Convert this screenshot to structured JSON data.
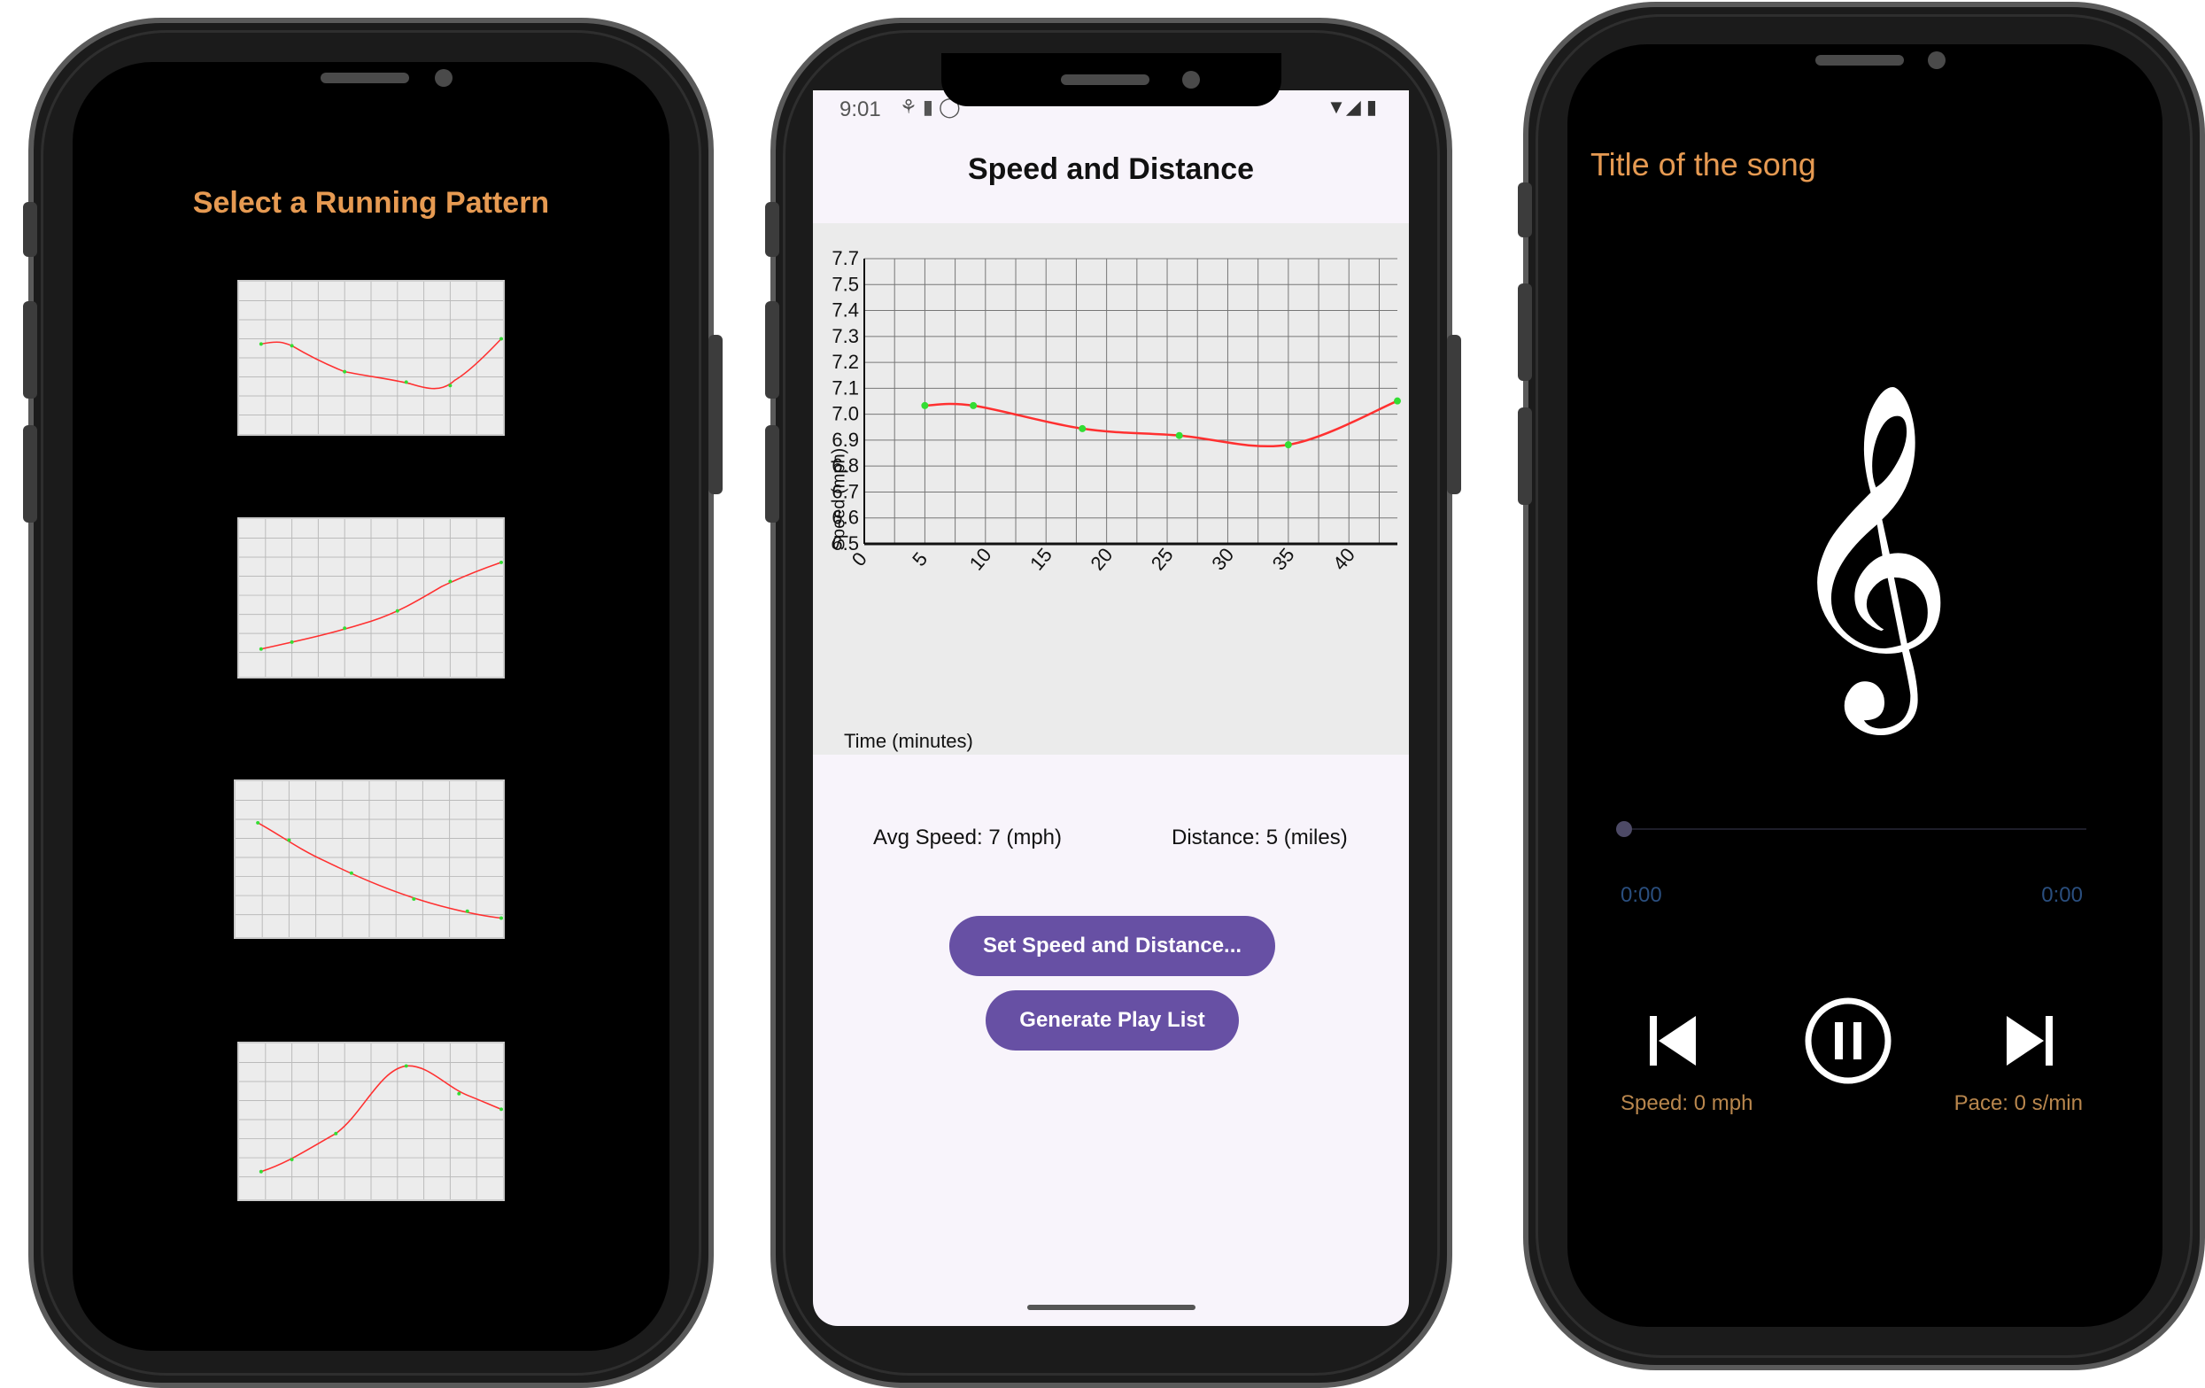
{
  "screen1": {
    "title": "Select a Running Pattern",
    "patterns": [
      {
        "name": "Wave"
      },
      {
        "name": "Rising"
      },
      {
        "name": "Falling"
      },
      {
        "name": "Hill"
      }
    ]
  },
  "screen2": {
    "status_time": "9:01",
    "title": "Speed and Distance",
    "avg_speed": "Avg Speed: 7 (mph)",
    "distance": "Distance: 5 (miles)",
    "set_button": "Set Speed and Distance...",
    "generate_button": "Generate Play List"
  },
  "screen3": {
    "song_title": "Title of the song",
    "time_elapsed": "0:00",
    "time_total": "0:00",
    "speed": "Speed: 0 mph",
    "pace": "Pace: 0 s/min",
    "icon": "treble-clef-icon",
    "progress": 0
  },
  "colors": {
    "accent": "#6750a4",
    "orange": "#e69a52",
    "curve": "#ff3030",
    "point": "#33dd33"
  },
  "chart_data": {
    "type": "line",
    "title": "",
    "xlabel": "Time (minutes)",
    "ylabel": "Speed (mph)",
    "x_ticks": [
      "0",
      "5",
      "10",
      "15",
      "20",
      "25",
      "30",
      "35",
      "40"
    ],
    "y_ticks": [
      "6.5",
      "6.6",
      "6.7",
      "6.8",
      "6.9",
      "7.0",
      "7.1",
      "7.2",
      "7.3",
      "7.4",
      "7.5",
      "7.7"
    ],
    "xlim": [
      0,
      44
    ],
    "ylim": [
      6.5,
      7.4
    ],
    "grid": true,
    "series": [
      {
        "x": [
          5,
          9,
          18,
          26,
          35,
          44
        ],
        "y": [
          7.1,
          7.1,
          7.0,
          6.97,
          6.93,
          7.12
        ]
      }
    ]
  }
}
